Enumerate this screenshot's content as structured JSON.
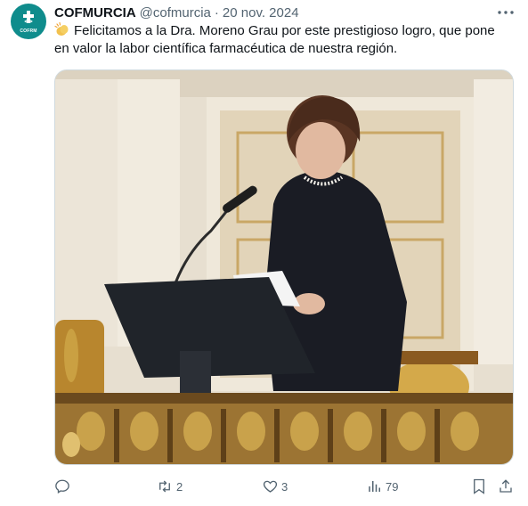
{
  "author": {
    "display_name": "COFMURCIA",
    "handle": "@cofmurcia",
    "separator": "·",
    "date": "20 nov. 2024",
    "avatar_label": "COFRM",
    "avatar_color": "#0f8c8c"
  },
  "tweet": {
    "emoji_icon": "clapping-hands-icon",
    "text": "Felicitamos a la Dra. Moreno Grau por este prestigioso logro, que pone en valor la labor científica farmacéutica de nuestra región."
  },
  "media": {
    "description_icon": "photo"
  },
  "actions": {
    "reply": {
      "icon": "reply-icon",
      "count": ""
    },
    "retweet": {
      "icon": "retweet-icon",
      "count": "2"
    },
    "like": {
      "icon": "heart-icon",
      "count": "3"
    },
    "views": {
      "icon": "views-bar-chart-icon",
      "count": "79"
    },
    "bookmark": {
      "icon": "bookmark-icon"
    },
    "share": {
      "icon": "share-icon"
    }
  },
  "colors": {
    "text": "#0f1419",
    "secondary": "#536471",
    "border": "#cfd9de"
  }
}
